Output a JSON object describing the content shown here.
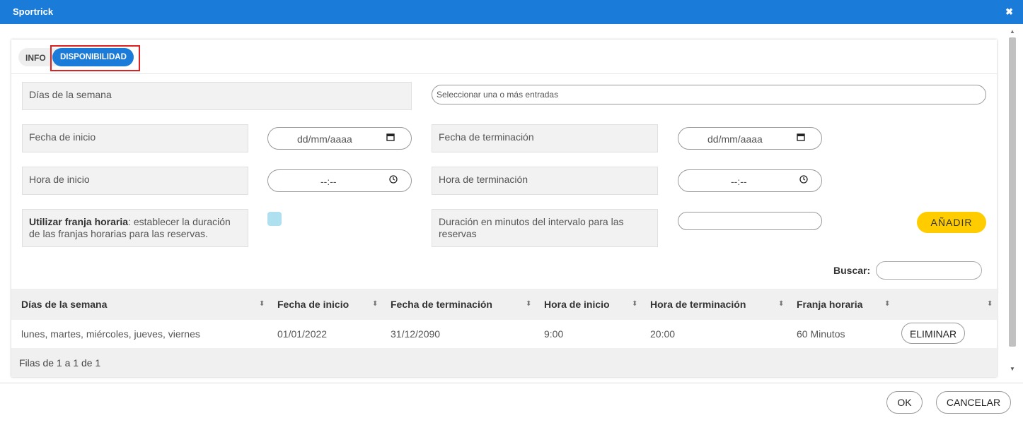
{
  "window": {
    "title": "Sportrick",
    "close_glyph": "✖"
  },
  "tabs": [
    {
      "label": "INFO",
      "active": false
    },
    {
      "label": "DISPONIBILIDAD",
      "active": true
    }
  ],
  "form": {
    "dias_label": "Días de la semana",
    "dias_placeholder": "Seleccionar una o más entradas",
    "fecha_inicio_label": "Fecha de inicio",
    "fecha_inicio_value": "dd/mm/aaaa",
    "fecha_fin_label": "Fecha de terminación",
    "fecha_fin_value": "dd/mm/aaaa",
    "hora_inicio_label": "Hora de inicio",
    "hora_inicio_value": "--:--",
    "hora_fin_label": "Hora de terminación",
    "hora_fin_value": "--:--",
    "franja_label_bold": "Utilizar franja horaria",
    "franja_label_rest": ": establecer la duración de las franjas horarias para las reservas.",
    "duracion_label": "Duración en minutos del intervalo para las reservas",
    "duracion_value": "",
    "add_button": "AÑADIR"
  },
  "search": {
    "label": "Buscar:",
    "value": ""
  },
  "table": {
    "columns": [
      "Días de la semana",
      "Fecha de inicio",
      "Fecha de terminación",
      "Hora de inicio",
      "Hora de terminación",
      "Franja horaria",
      ""
    ],
    "rows": [
      {
        "dias": "lunes, martes, miércoles, jueves, viernes",
        "fecha_inicio": "01/01/2022",
        "fecha_fin": "31/12/2090",
        "hora_inicio": "9:00",
        "hora_fin": "20:00",
        "franja": "60 Minutos",
        "action": "ELIMINAR"
      }
    ],
    "footer": "Filas de 1 a 1 de 1"
  },
  "footer": {
    "ok": "OK",
    "cancel": "CANCELAR"
  },
  "icons": {
    "calendar": "calendar-icon",
    "clock": "clock-icon",
    "sort": "sort-icon"
  },
  "colors": {
    "primary": "#1a7bd8",
    "accent": "#ffcc00",
    "highlight": "#e02020",
    "checkbox": "#aee0f0"
  }
}
